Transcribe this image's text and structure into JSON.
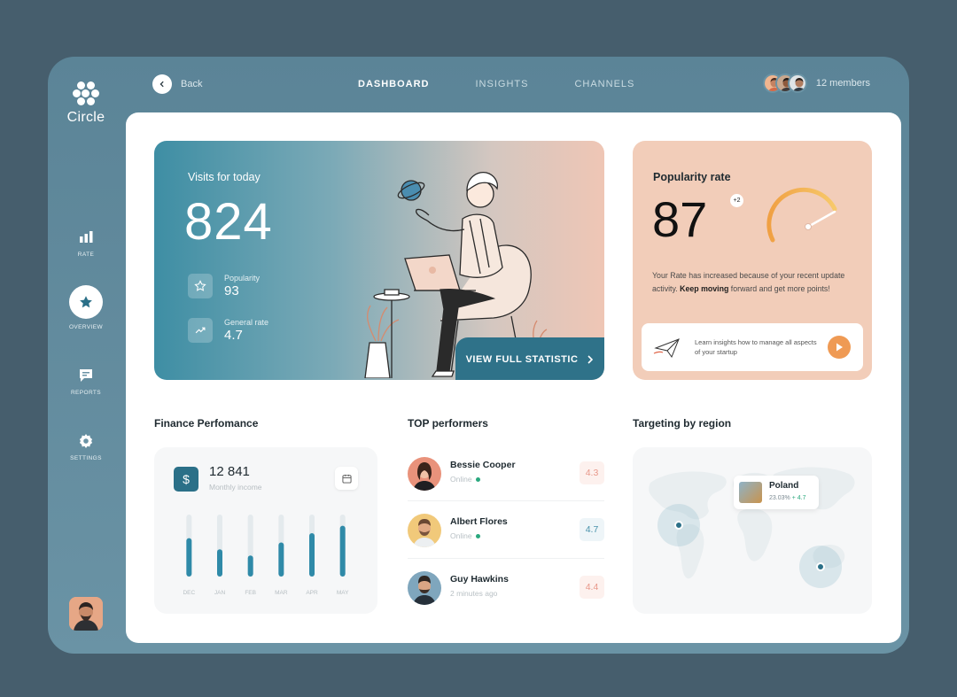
{
  "app": {
    "name": "Circle"
  },
  "sidebar": {
    "items": [
      {
        "label": "RATE",
        "icon": "bar-chart-icon"
      },
      {
        "label": "OVERVIEW",
        "icon": "star-icon",
        "active": true
      },
      {
        "label": "REPORTS",
        "icon": "message-icon"
      },
      {
        "label": "SETTINGS",
        "icon": "gear-icon"
      }
    ]
  },
  "topbar": {
    "back_label": "Back",
    "tabs": [
      {
        "label": "DASHBOARD",
        "active": true
      },
      {
        "label": "INSIGHTS"
      },
      {
        "label": "CHANNELS"
      }
    ],
    "members_label": "12 members"
  },
  "visits": {
    "title": "Visits for today",
    "value": "824",
    "stats": [
      {
        "label": "Popularity",
        "value": "93",
        "icon": "star-icon"
      },
      {
        "label": "General rate",
        "value": "4.7",
        "icon": "trend-icon"
      }
    ],
    "button_label": "VIEW FULL STATISTIC"
  },
  "popularity": {
    "title": "Popularity rate",
    "value": "87",
    "badge": "+2",
    "gauge_level": 0.87,
    "desc_pre": "Your Rate has increased because of your recent update activity. ",
    "desc_bold": "Keep moving",
    "desc_post": " forward and get more points!",
    "cta_text": "Learn insights how to manage all aspects of your startup"
  },
  "finance": {
    "title": "Finance Perfomance",
    "amount": "12 841",
    "subtitle": "Monthly income",
    "months": [
      "DEC",
      "JAN",
      "FEB",
      "MAR",
      "APR",
      "MAY"
    ],
    "levels": [
      0.62,
      0.44,
      0.34,
      0.55,
      0.7,
      0.82
    ]
  },
  "performers": {
    "title": "TOP performers",
    "items": [
      {
        "name": "Bessie Cooper",
        "status": "Online",
        "online": true,
        "score": "4.3",
        "score_color": "#e8988a",
        "score_bg": "#fdf1ee"
      },
      {
        "name": "Albert Flores",
        "status": "Online",
        "online": true,
        "score": "4.7",
        "score_color": "#4a92ab",
        "score_bg": "#eef5f8"
      },
      {
        "name": "Guy Hawkins",
        "status": "2 minutes ago",
        "online": false,
        "score": "4.4",
        "score_color": "#e8988a",
        "score_bg": "#fdf1ee"
      }
    ]
  },
  "region": {
    "title": "Targeting by region",
    "country": "Poland",
    "percent": "23.03%",
    "delta": "+ 4.7"
  },
  "colors": {
    "accent": "#2b7088",
    "orange": "#ef9a54",
    "peach": "#f2cdb9"
  }
}
